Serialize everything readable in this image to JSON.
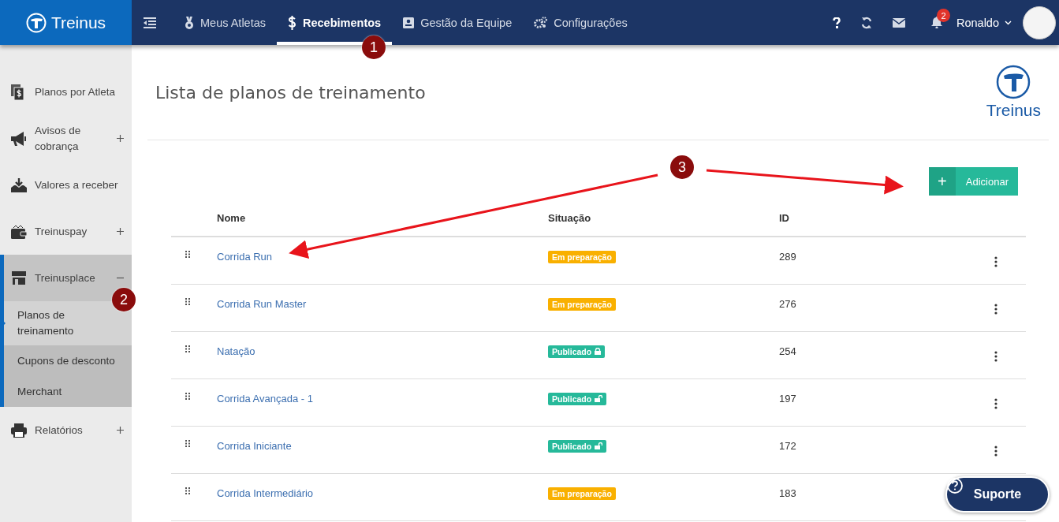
{
  "topbar": {
    "brand": "Treinus",
    "nav": [
      {
        "label": "Meus Atletas",
        "selected": false
      },
      {
        "label": "Recebimentos",
        "selected": true
      },
      {
        "label": "Gestão da Equipe",
        "selected": false
      },
      {
        "label": "Configurações",
        "selected": false
      }
    ],
    "notification_count": "2",
    "user": "Ronaldo"
  },
  "sidebar": {
    "items": [
      {
        "label": "Planos por Atleta"
      },
      {
        "label": "Avisos de cobrança",
        "expanded": false
      },
      {
        "label": "Valores a receber"
      },
      {
        "label": "Treinuspay",
        "expanded": false
      },
      {
        "label": "Treinusplace",
        "expanded": true,
        "children": [
          {
            "label": "Planos de treinamento",
            "selected": true
          },
          {
            "label": "Cupons de desconto",
            "selected": false
          },
          {
            "label": "Merchant",
            "selected": false
          }
        ]
      },
      {
        "label": "Relatórios",
        "expanded": false
      }
    ]
  },
  "page": {
    "title": "Lista de planos de treinamento",
    "logo_text": "Treinus",
    "add_button": {
      "icon": "+",
      "label": "Adicionar"
    }
  },
  "table": {
    "columns": [
      "Nome",
      "Situação",
      "ID"
    ],
    "rows": [
      {
        "name": "Corrida Run",
        "status": {
          "label": "Em preparação",
          "kind": "preparing"
        },
        "id": "289"
      },
      {
        "name": "Corrida Run Master",
        "status": {
          "label": "Em preparação",
          "kind": "preparing"
        },
        "id": "276"
      },
      {
        "name": "Natação",
        "status": {
          "label": "Publicado",
          "kind": "published",
          "locked": true
        },
        "id": "254"
      },
      {
        "name": "Corrida Avançada - 1",
        "status": {
          "label": "Publicado",
          "kind": "published",
          "locked": false
        },
        "id": "197"
      },
      {
        "name": "Corrida Iniciante",
        "status": {
          "label": "Publicado",
          "kind": "published",
          "locked": false
        },
        "id": "172"
      },
      {
        "name": "Corrida Intermediário",
        "status": {
          "label": "Em preparação",
          "kind": "preparing"
        },
        "id": "183"
      }
    ]
  },
  "support_button": "Suporte",
  "callouts": [
    {
      "number": "1"
    },
    {
      "number": "2"
    },
    {
      "number": "3"
    }
  ]
}
